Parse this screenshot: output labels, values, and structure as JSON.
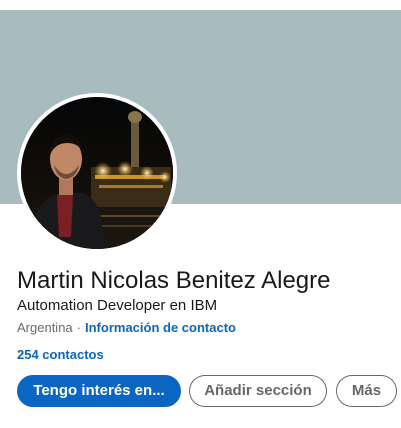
{
  "colors": {
    "cover": "#a8bcbf",
    "link": "#0a66c2",
    "primary_button": "#0a66c2"
  },
  "profile": {
    "name": "Martin Nicolas Benitez Alegre",
    "headline": "Automation Developer en IBM",
    "location": "Argentina",
    "separator": "·",
    "contact_info_link": "Información de contacto",
    "connections": "254 contactos"
  },
  "actions": {
    "primary_label": "Tengo interés en...",
    "add_section_label": "Añadir sección",
    "more_label": "Más"
  }
}
